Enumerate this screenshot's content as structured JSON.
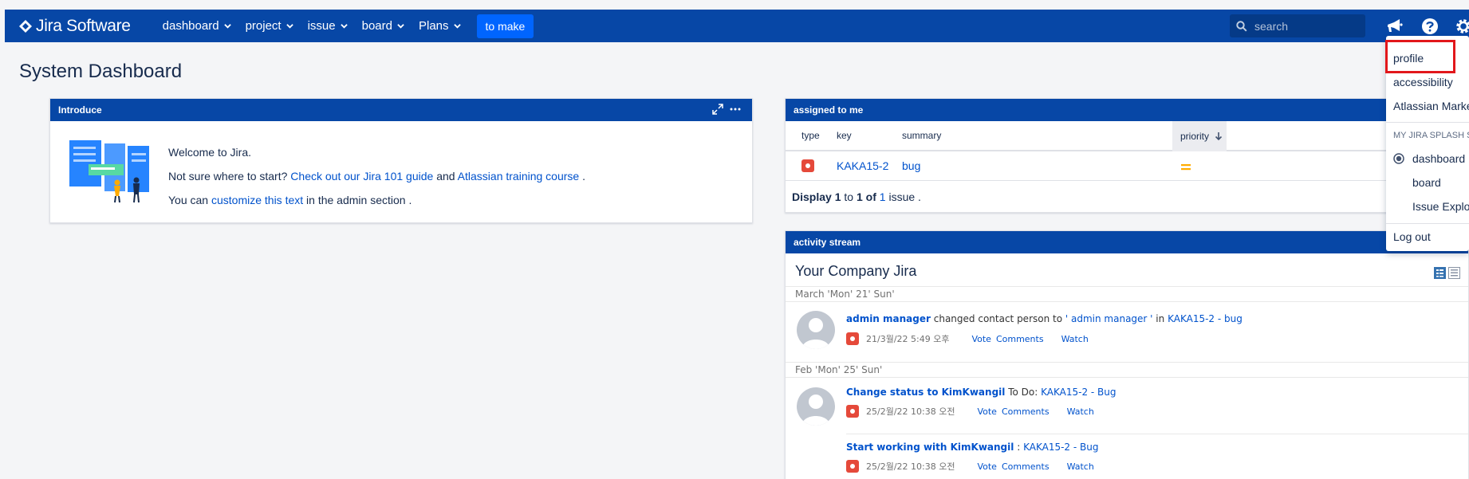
{
  "header": {
    "brand": "Jira Software",
    "nav": [
      {
        "label": "dashboard"
      },
      {
        "label": "project"
      },
      {
        "label": "issue"
      },
      {
        "label": "board"
      },
      {
        "label": "Plans"
      }
    ],
    "create_label": "to make",
    "search_placeholder": "search"
  },
  "page": {
    "title": "System Dashboard"
  },
  "introduce": {
    "title": "Introduce",
    "welcome": "Welcome to Jira.",
    "line2_prefix": "Not sure where to start?",
    "line2_link1": "Check out our Jira 101 guide",
    "line2_and": "and",
    "line2_link2": "Atlassian training course",
    "line2_suffix": ".",
    "line3_prefix": "You can",
    "line3_link": "customize this text",
    "line3_suffix": "in the admin section ."
  },
  "assigned": {
    "title": "assigned to me",
    "columns": {
      "type": "type",
      "key": "key",
      "summary": "summary",
      "priority": "priority"
    },
    "rows": [
      {
        "key": "KAKA15-2",
        "summary": "bug"
      }
    ],
    "display_prefix": "Display",
    "display_from": "1",
    "display_to_word": "to",
    "display_to": "1",
    "display_of_word": "of",
    "display_total": "1",
    "display_suffix": "issue ."
  },
  "activity": {
    "title": "activity stream",
    "company": "Your Company Jira",
    "groups": [
      {
        "date": "March 'Mon' 21' Sun'",
        "entries": [
          {
            "actor": "admin manager",
            "text": "changed contact person to",
            "target_quote": "' admin manager '",
            "in_word": "in",
            "issue": "KAKA15-2 - bug",
            "time": "21/3월/22 5:49 오후",
            "actions": [
              "Vote",
              "Comments",
              "Watch"
            ]
          }
        ]
      },
      {
        "date": "Feb 'Mon' 25' Sun'",
        "entries": [
          {
            "actor": "Change status to KimKwangil",
            "text": "To Do:",
            "issue": "KAKA15-2 - Bug",
            "time": "25/2월/22 10:38 오전",
            "actions": [
              "Vote",
              "Comments",
              "Watch"
            ]
          },
          {
            "actor": "Start working with KimKwangil",
            "text": ":",
            "issue": "KAKA15-2 - Bug",
            "time": "25/2월/22 10:38 오전",
            "actions": [
              "Vote",
              "Comments",
              "Watch"
            ]
          }
        ]
      }
    ]
  },
  "profile_menu": {
    "items": [
      "profile",
      "accessibility",
      "Atlassian Marke"
    ],
    "section": "MY JIRA SPLASH SC",
    "radio_items": [
      "dashboard",
      "board",
      "Issue Explor"
    ],
    "logout": "Log out"
  },
  "colors": {
    "topbar": "#0747a6",
    "create": "#0065ff",
    "link": "#0052cc",
    "bug": "#e5493a",
    "priority": "#ffab00",
    "highlight": "#e2171b"
  }
}
